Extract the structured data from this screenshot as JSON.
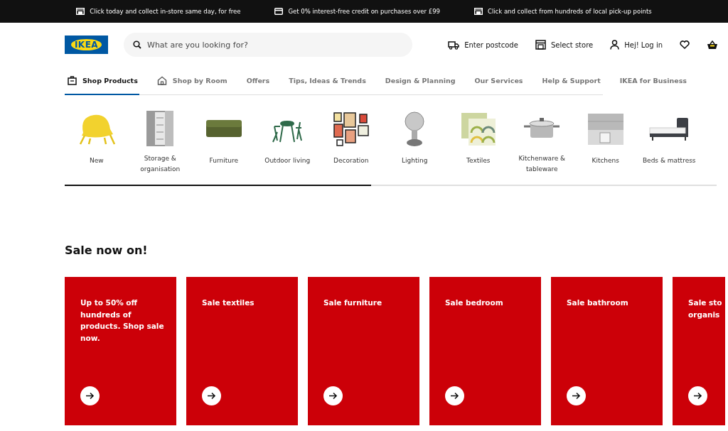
{
  "promo_bar": [
    {
      "text": "Click today and collect in-store same day, for free"
    },
    {
      "text": "Get 0% interest-free credit on purchases over £99"
    },
    {
      "text": "Click and collect from hundreds of local pick-up points"
    }
  ],
  "header": {
    "logo": "IKEA",
    "search": {
      "placeholder": "What are you looking for?"
    },
    "actions": [
      {
        "kind": "delivery",
        "label": "Enter postcode"
      },
      {
        "kind": "store",
        "label": "Select store"
      },
      {
        "kind": "user",
        "label": "Hej! Log in"
      },
      {
        "kind": "favourites"
      },
      {
        "kind": "basket"
      }
    ]
  },
  "nav": [
    {
      "label": "Shop Products",
      "selected": true
    },
    {
      "label": "Shop by Room",
      "selected": false
    },
    {
      "label": "Offers",
      "selected": false
    },
    {
      "label": "Tips, Ideas & Trends",
      "selected": false
    },
    {
      "label": "Design & Planning",
      "selected": false
    },
    {
      "label": "Our Services",
      "selected": false
    },
    {
      "label": "Help & Support",
      "selected": false
    },
    {
      "label": "IKEA for Business",
      "selected": false
    }
  ],
  "categories": [
    {
      "label": "New"
    },
    {
      "label": "Storage & organisation"
    },
    {
      "label": "Furniture"
    },
    {
      "label": "Outdoor living"
    },
    {
      "label": "Decoration"
    },
    {
      "label": "Lighting"
    },
    {
      "label": "Textiles"
    },
    {
      "label": "Kitchenware & tableware"
    },
    {
      "label": "Kitchens"
    },
    {
      "label": "Beds & mattress"
    }
  ],
  "category_scroll": {
    "level": 0.47
  },
  "sale": {
    "heading": "Sale now on!",
    "cards": [
      {
        "title": "Up to 50% off hundreds of products. Shop sale now."
      },
      {
        "title": "Sale textiles"
      },
      {
        "title": "Sale furniture"
      },
      {
        "title": "Sale bedroom"
      },
      {
        "title": "Sale bathroom"
      },
      {
        "title": "Sale sto\norganis",
        "cut": true
      }
    ]
  }
}
